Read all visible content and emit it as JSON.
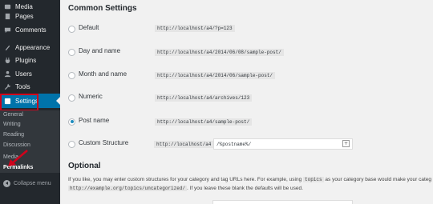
{
  "sidebar": {
    "items": [
      {
        "label": "Media",
        "icon": "media-icon"
      },
      {
        "label": "Pages",
        "icon": "pages-icon"
      },
      {
        "label": "Comments",
        "icon": "comments-icon"
      },
      {
        "label": "Appearance",
        "icon": "appearance-icon"
      },
      {
        "label": "Plugins",
        "icon": "plugins-icon"
      },
      {
        "label": "Users",
        "icon": "users-icon"
      },
      {
        "label": "Tools",
        "icon": "tools-icon"
      },
      {
        "label": "Settings",
        "icon": "settings-icon",
        "active": true
      }
    ],
    "submenu": [
      "General",
      "Writing",
      "Reading",
      "Discussion",
      "Media",
      "Permalinks"
    ],
    "current_submenu": "Permalinks",
    "collapse_label": "Collapse menu"
  },
  "main": {
    "common_title": "Common Settings",
    "options": [
      {
        "label": "Default",
        "code": "http://localhost/a4/?p=123",
        "checked": false
      },
      {
        "label": "Day and name",
        "code": "http://localhost/a4/2014/06/08/sample-post/",
        "checked": false
      },
      {
        "label": "Month and name",
        "code": "http://localhost/a4/2014/06/sample-post/",
        "checked": false
      },
      {
        "label": "Numeric",
        "code": "http://localhost/a4/archives/123",
        "checked": false
      },
      {
        "label": "Post name",
        "code": "http://localhost/a4/sample-post/",
        "checked": true
      },
      {
        "label": "Custom Structure",
        "code": "http://localhost/a4",
        "checked": false
      }
    ],
    "custom_value": "/%postname%/",
    "optional_title": "Optional",
    "desc_line1_a": "If you like, you may enter custom structures for your category and tag URLs here. For example, using",
    "desc_line1_code": "topics",
    "desc_line1_b": "as your category base would make your categ",
    "desc_line2_code": "http://example.org/topics/uncategorized/",
    "desc_line2_b": ". If you leave these blank the defaults will be used."
  },
  "colors": {
    "sidebar_bg": "#23282d",
    "active_bg": "#0073aa",
    "annotation_red": "#d0021b"
  }
}
